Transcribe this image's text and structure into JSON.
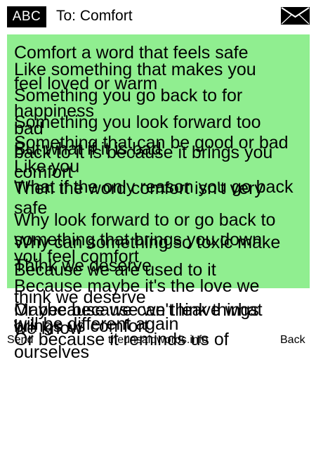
{
  "header": {
    "badge": "ABC",
    "to": "To: Comfort",
    "mail_icon": "envelope-icon"
  },
  "message": {
    "background": "#90ee90",
    "lines": [
      "Comfort a word that feels safe",
      "Like something that makes you feel loved or warm",
      "Something you go back to for happiness",
      "Something you look forward too",
      "bad",
      "Something that can be good or bad",
      "But what if it is bad",
      "back to it is because it brings you comfort",
      "Like you",
      "What if the only reason you go back",
      "Then the word comfort isn't very safe",
      "Why look forward to or go back to something that brings you down",
      "Why can something so toxic make you feel comfort",
      "Think we deserve",
      "Because we are used to it",
      "Because maybe it's the love we think we deserve",
      "Or because we can't leave what we know",
      "Maybe because we think things will be different again",
      "brings us comfort",
      "Or because it reminds us of ourselves"
    ]
  },
  "footer": {
    "send": "Send",
    "site": "theunsaidwords.info",
    "back": "Back"
  }
}
